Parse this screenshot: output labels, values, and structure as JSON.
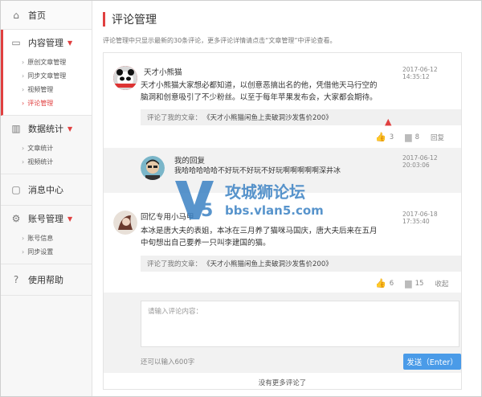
{
  "sidebar": {
    "home": "首页",
    "groups": [
      {
        "label": "内容管理",
        "subs": [
          "原创文章管理",
          "同步文章管理",
          "视频管理",
          "评论管理"
        ]
      },
      {
        "label": "数据统计",
        "subs": [
          "文章统计",
          "视频统计"
        ]
      },
      {
        "label": "消息中心"
      },
      {
        "label": "账号管理",
        "subs": [
          "账号信息",
          "同步设置"
        ]
      },
      {
        "label": "使用帮助"
      }
    ]
  },
  "page": {
    "title": "评论管理",
    "notice": "评论管理中只显示最新的30条评论，更多评论详情请点击“文章管理”中评论查看。"
  },
  "comments": [
    {
      "name": "天才小熊猫",
      "time": "2017-06-12  14:35:12",
      "body_line1": "天才小熊猫大家想必都知道，以创意恶搞出名的他，凭借他天马行空的",
      "body_line2": "脑洞和创意吸引了不少粉丝。以至于每年苹果发布会，大家都会期待。",
      "quote_prefix": "评论了我的文章：",
      "quote_link": "《天才小熊猫闲鱼上卖破洞沙发售价200》",
      "likes": "3",
      "replies": "8",
      "reply_label": "回复"
    },
    {
      "name": "回忆专用小马甲",
      "time": "2017-06-18  17:35:40",
      "body_line1": "本冰是唐大夫的表姐，本冰在三月养了猫咪马国庆，唐大夫后来在五月",
      "body_line2": "中旬想出自己要养一只叫李建国的猫。",
      "quote_prefix": "评论了我的文章：",
      "quote_link": "《天才小熊猫闲鱼上卖破洞沙发售价200》",
      "likes": "6",
      "replies": "15",
      "collapse_label": "收起"
    }
  ],
  "my_reply": {
    "name": "我的回复",
    "time": "2017-06-12  20:03:06",
    "body": "我哈哈哈哈哈不好玩不好玩不好玩啊啊啊啊啊深井冰"
  },
  "composer": {
    "placeholder": "请输入评论内容：",
    "remaining": "还可以输入600字",
    "send_label": "发送（Enter）"
  },
  "footer": {
    "no_more": "没有更多评论了"
  },
  "watermark": {
    "brand": "攻城狮论坛",
    "url": "bbs.vlan5.com",
    "logo": "V5"
  },
  "colors": {
    "accent": "#e04040",
    "button": "#4a9be8"
  }
}
